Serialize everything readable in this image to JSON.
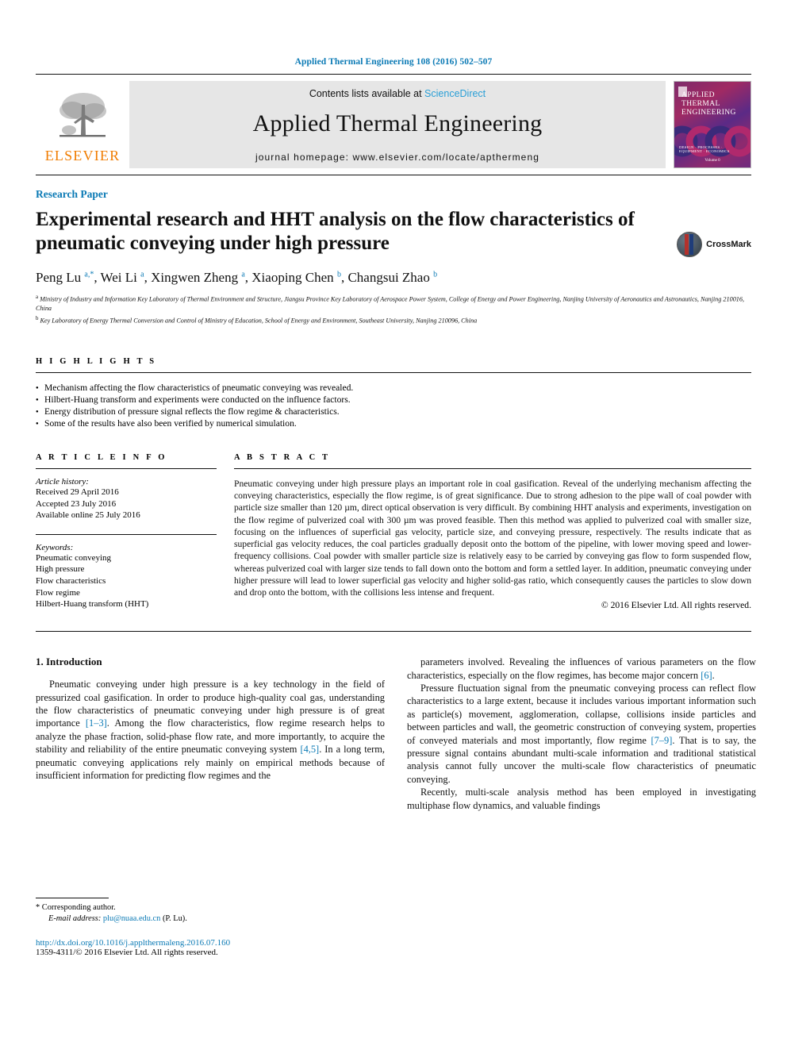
{
  "running_head": "Applied Thermal Engineering 108 (2016) 502–507",
  "masthead": {
    "publisher": "ELSEVIER",
    "contents_prefix": "Contents lists available at ",
    "contents_link": "ScienceDirect",
    "journal_name": "Applied Thermal Engineering",
    "homepage": "journal homepage: www.elsevier.com/locate/apthermeng",
    "cover": {
      "line1": "APPLIED",
      "line2": "THERMAL",
      "line3": "ENGINEERING",
      "footer": "DESIGN · PROCESSES · EQUIPMENT · ECONOMICS",
      "volume": "Volume 0"
    }
  },
  "article": {
    "type": "Research Paper",
    "title": "Experimental research and HHT analysis on the flow characteristics of pneumatic conveying under high pressure",
    "crossmark_label": "CrossMark",
    "authors_html": "Peng Lu <sup>a,*</sup>, Wei Li <sup>a</sup>, Xingwen Zheng <sup>a</sup>, Xiaoping Chen <sup>b</sup>, Changsui Zhao <sup>b</sup>",
    "affiliations": [
      "a Ministry of Industry and Information Key Laboratory of Thermal Environment and Structure, Jiangsu Province Key Laboratory of Aerospace Power System, College of Energy and Power Engineering, Nanjing University of Aeronautics and Astronautics, Nanjing 210016, China",
      "b Key Laboratory of Energy Thermal Conversion and Control of Ministry of Education, School of Energy and Environment, Southeast University, Nanjing 210096, China"
    ]
  },
  "highlights": {
    "label": "H I G H L I G H T S",
    "items": [
      "Mechanism affecting the flow characteristics of pneumatic conveying was revealed.",
      "Hilbert-Huang transform and experiments were conducted on the influence factors.",
      "Energy distribution of pressure signal reflects the flow regime & characteristics.",
      "Some of the results have also been verified by numerical simulation."
    ]
  },
  "article_info": {
    "label": "A R T I C L E   I N F O",
    "history_label": "Article history:",
    "history": [
      "Received 29 April 2016",
      "Accepted 23 July 2016",
      "Available online 25 July 2016"
    ],
    "keywords_label": "Keywords:",
    "keywords": [
      "Pneumatic conveying",
      "High pressure",
      "Flow characteristics",
      "Flow regime",
      "Hilbert-Huang transform (HHT)"
    ]
  },
  "abstract": {
    "label": "A B S T R A C T",
    "text": "Pneumatic conveying under high pressure plays an important role in coal gasification. Reveal of the underlying mechanism affecting the conveying characteristics, especially the flow regime, is of great significance. Due to strong adhesion to the pipe wall of coal powder with particle size smaller than 120 µm, direct optical observation is very difficult. By combining HHT analysis and experiments, investigation on the flow regime of pulverized coal with 300 µm was proved feasible. Then this method was applied to pulverized coal with smaller size, focusing on the influences of superficial gas velocity, particle size, and conveying pressure, respectively. The results indicate that as superficial gas velocity reduces, the coal particles gradually deposit onto the bottom of the pipeline, with lower moving speed and lower-frequency collisions. Coal powder with smaller particle size is relatively easy to be carried by conveying gas flow to form suspended flow, whereas pulverized coal with larger size tends to fall down onto the bottom and form a settled layer. In addition, pneumatic conveying under higher pressure will lead to lower superficial gas velocity and higher solid-gas ratio, which consequently causes the particles to slow down and drop onto the bottom, with the collisions less intense and frequent.",
    "copyright": "© 2016 Elsevier Ltd. All rights reserved."
  },
  "body": {
    "section_heading": "1. Introduction",
    "left_paragraphs": [
      {
        "pre": "Pneumatic conveying under high pressure is a key technology in the field of pressurized coal gasification. In order to produce high-quality coal gas, understanding the flow characteristics of pneumatic conveying under high pressure is of great importance ",
        "ref1": "[1–3]",
        "mid": ". Among the flow characteristics, flow regime research helps to analyze the phase fraction, solid-phase flow rate, and more importantly, to acquire the stability and reliability of the entire pneumatic conveying system ",
        "ref2": "[4,5]",
        "post": ". In a long term, pneumatic conveying applications rely mainly on empirical methods because of insufficient information for predicting flow regimes and the"
      }
    ],
    "right_paragraphs": [
      {
        "pre": "parameters involved. Revealing the influences of various parameters on the flow characteristics, especially on the flow regimes, has become major concern ",
        "ref1": "[6]",
        "post": "."
      },
      {
        "pre": "Pressure fluctuation signal from the pneumatic conveying process can reflect flow characteristics to a large extent, because it includes various important information such as particle(s) movement, agglomeration, collapse, collisions inside particles and between particles and wall, the geometric construction of conveying system, properties of conveyed materials and most importantly, flow regime ",
        "ref1": "[7–9]",
        "post": ". That is to say, the pressure signal contains abundant multi-scale information and traditional statistical analysis cannot fully uncover the multi-scale flow characteristics of pneumatic conveying."
      },
      {
        "pre": "Recently, multi-scale analysis method has been employed in investigating multiphase flow dynamics, and valuable findings",
        "ref1": "",
        "post": ""
      }
    ]
  },
  "footnotes": {
    "corresponding": "* Corresponding author.",
    "email_label": "E-mail address:",
    "email": "plu@nuaa.edu.cn",
    "email_suffix": "(P. Lu).",
    "doi": "http://dx.doi.org/10.1016/j.applthermaleng.2016.07.160",
    "issn": "1359-4311/© 2016 Elsevier Ltd. All rights reserved."
  },
  "colors": {
    "link": "#0b7ab5",
    "elsevier_orange": "#f07c00",
    "sciencedirect": "#2a9fd6"
  }
}
